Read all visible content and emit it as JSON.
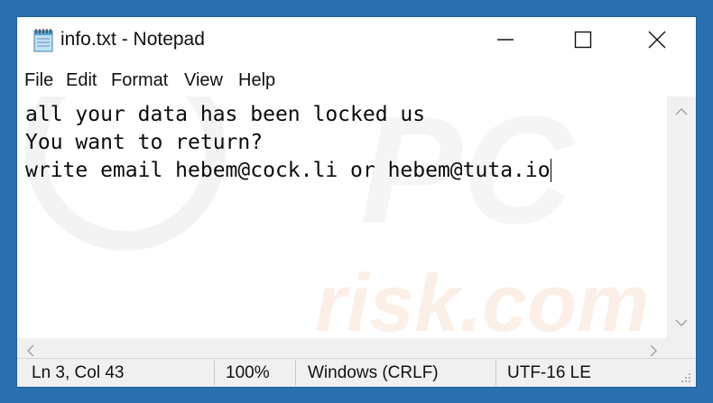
{
  "window": {
    "title": "info.txt - Notepad",
    "icon": "notepad-icon"
  },
  "controls": {
    "minimize_icon": "minimize-icon",
    "maximize_icon": "maximize-icon",
    "close_icon": "close-icon"
  },
  "menu": {
    "items": [
      {
        "label": "File"
      },
      {
        "label": "Edit"
      },
      {
        "label": "Format"
      },
      {
        "label": "View"
      },
      {
        "label": "Help"
      }
    ]
  },
  "document": {
    "lines": [
      "all your data has been locked us",
      "You want to return?",
      "write email hebem@cock.li or hebem@tuta.io"
    ]
  },
  "watermark": {
    "text": "risk.com"
  },
  "statusbar": {
    "position": "Ln 3, Col 43",
    "zoom": "100%",
    "line_ending": "Windows (CRLF)",
    "encoding": "UTF-16 LE"
  },
  "colors": {
    "background": "#2a6fb0",
    "window": "#ffffff",
    "chrome": "#f0f0f0"
  }
}
